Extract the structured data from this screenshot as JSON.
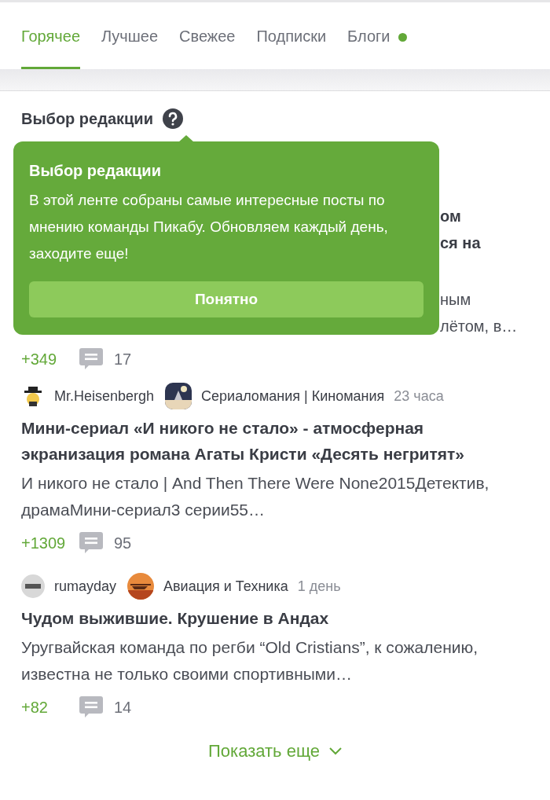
{
  "tabs": [
    {
      "label": "Горячее",
      "selected": true,
      "dot": false
    },
    {
      "label": "Лучшее",
      "selected": false,
      "dot": false
    },
    {
      "label": "Свежее",
      "selected": false,
      "dot": false
    },
    {
      "label": "Подписки",
      "selected": false,
      "dot": false
    },
    {
      "label": "Блоги",
      "selected": false,
      "dot": true
    }
  ],
  "section_title": "Выбор редакции",
  "tooltip": {
    "title": "Выбор редакции",
    "text": "В этой ленте собраны самые интересные посты по мнению команды Пикабу. Обновляем каждый день, заходите еще!",
    "button": "Понятно"
  },
  "posts": [
    {
      "kind": "partial",
      "title_lines": [
        "ом",
        "ся на"
      ],
      "excerpt_lines": [
        "ным",
        "лётом, в…"
      ],
      "rating": "+349",
      "comments": "17"
    },
    {
      "kind": "full",
      "author": "Mr.Heisenbergh",
      "community": "Сериаломания | Киномания",
      "time": "23 часа",
      "title": "Мини-сериал «И никого не стало» - атмосферная экранизация романа Агаты Кристи «Десять негритят»",
      "excerpt": "И никого не стало | And Then There Were None2015Детектив, драмаМини-сериал3 серии55…",
      "rating": "+1309",
      "comments": "95"
    },
    {
      "kind": "full",
      "author": "rumayday",
      "community": "Авиация и Техника",
      "time": "1 день",
      "title": "Чудом выжившие. Крушение в Андах",
      "excerpt": "Уругвайская команда по регби “Old Cristians”, к сожалению, известна не только своими спортивными…",
      "rating": "+82",
      "comments": "14"
    }
  ],
  "show_more": "Показать еще"
}
